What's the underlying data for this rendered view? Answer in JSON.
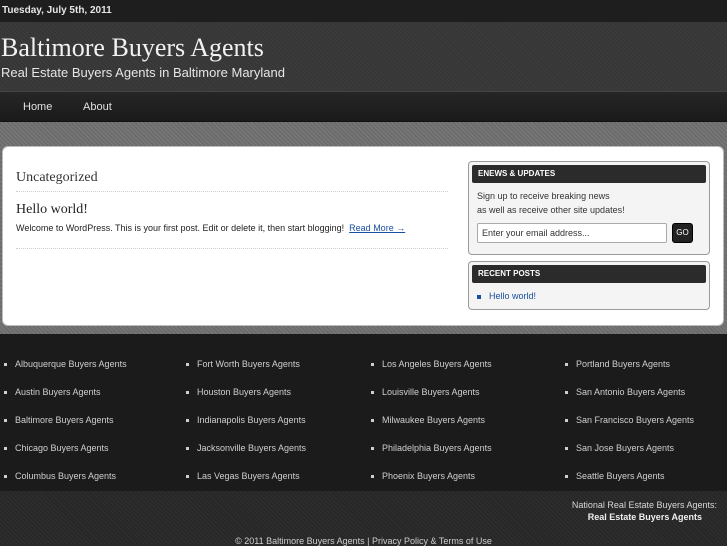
{
  "topbar": {
    "date": "Tuesday, July 5th, 2011"
  },
  "header": {
    "title": "Baltimore Buyers Agents",
    "description": "Real Estate Buyers Agents in Baltimore Maryland"
  },
  "nav": {
    "items": [
      "Home",
      "About"
    ]
  },
  "content": {
    "category_title": "Uncategorized",
    "post": {
      "title": "Hello world!",
      "excerpt": "Welcome to WordPress. This is your first post. Edit or delete it, then start blogging!",
      "read_more": "Read More →"
    }
  },
  "sidebar": {
    "enews": {
      "heading": "ENEWS & UPDATES",
      "line1": "Sign up to receive breaking news",
      "line2": "as well as receive other site updates!",
      "email_value": "Enter your email address...",
      "go_label": "GO"
    },
    "recent_posts": {
      "heading": "RECENT POSTS",
      "items": [
        "Hello world!"
      ]
    }
  },
  "footer_links": {
    "columns": [
      [
        "Albuquerque Buyers Agents",
        "Austin Buyers Agents",
        "Baltimore Buyers Agents",
        "Chicago Buyers Agents",
        "Columbus Buyers Agents"
      ],
      [
        "Fort Worth Buyers Agents",
        "Houston Buyers Agents",
        "Indianapolis Buyers Agents",
        "Jacksonville Buyers Agents",
        "Las Vegas Buyers Agents"
      ],
      [
        "Los Angeles Buyers Agents",
        "Louisville Buyers Agents",
        "Milwaukee Buyers Agents",
        "Philadelphia Buyers Agents",
        "Phoenix Buyers Agents"
      ],
      [
        "Portland Buyers Agents",
        "San Antonio Buyers Agents",
        "San Francisco Buyers Agents",
        "San Jose Buyers Agents",
        "Seattle Buyers Agents"
      ]
    ]
  },
  "footer": {
    "national_label": "National Real Estate Buyers Agents:",
    "national_link": "Real Estate Buyers Agents",
    "copyright": "© 2011 Baltimore Buyers Agents | Privacy Policy & Terms of Use"
  }
}
